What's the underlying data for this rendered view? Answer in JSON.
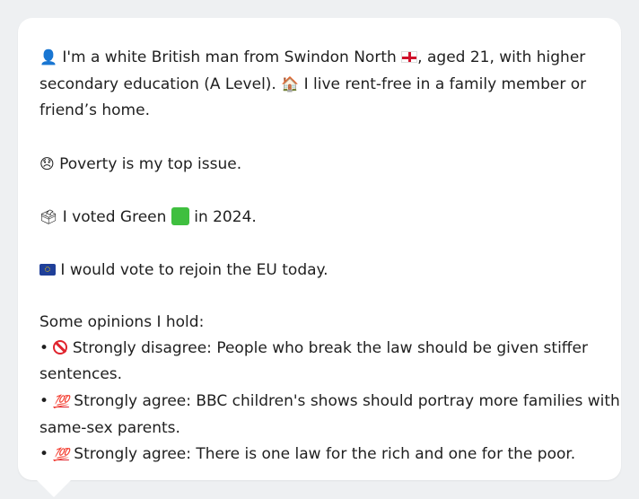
{
  "profile": {
    "line1": "I'm a white British man from Swindon North",
    "line1b": ", aged 21, with higher",
    "line2a": "secondary education (A Level).",
    "line2b": "I live rent-free in a family member or",
    "line3": "friend’s home.",
    "top_issue": "Poverty is my top issue.",
    "vote_a": "I voted Green",
    "vote_b": "in 2024.",
    "eu": "I would vote to rejoin the EU today.",
    "opinions_heading": "Some opinions I hold:",
    "opinions": [
      {
        "bullet": "•",
        "icon": "prohibited-icon",
        "line_a": "Strongly disagree: People who break the law should be given stiffer",
        "line_b": "sentences."
      },
      {
        "bullet": "•",
        "icon": "hundred-points-icon",
        "line_a": "Strongly agree: BBC children's shows should portray more families with",
        "line_b": "same-sex parents."
      },
      {
        "bullet": "•",
        "icon": "hundred-points-icon",
        "line_a": "Strongly agree: There is one law for the rich and one for the poor."
      }
    ]
  },
  "icons": {
    "person": "👤",
    "house": "🏠",
    "sad": "😞",
    "ballot": "🗳",
    "hundred": "💯"
  },
  "colors": {
    "background": "#eef0f2",
    "card": "#ffffff",
    "text": "#1f1f1f",
    "green": "#3fbf3f",
    "red": "#e0242e"
  }
}
